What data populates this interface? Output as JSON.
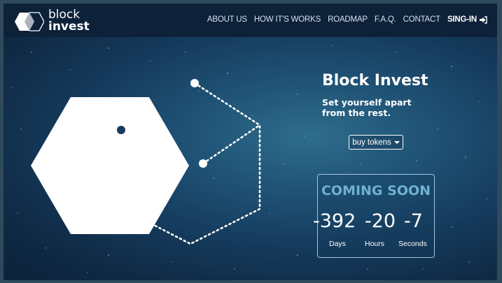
{
  "nav": {
    "logo_line1": "block",
    "logo_line2": "invest",
    "links": [
      "ABOUT US",
      "HOW IT'S WORKS",
      "ROADMAP",
      "F.A.Q.",
      "CONTACT"
    ],
    "signin_label": "SING-IN",
    "signin_icon": "sign-in-icon"
  },
  "hero": {
    "title": "Block Invest",
    "subtitle": "Set yourself apart from the rest.",
    "buy_label": "buy tokens",
    "buy_icon": "caret-down-icon"
  },
  "countdown": {
    "heading": "COMING SOON",
    "days": "-392",
    "hours": "-20",
    "seconds": "-7",
    "days_label": "Days",
    "hours_label": "Hours",
    "seconds_label": "Seconds"
  },
  "colors": {
    "navbar": "#0d2139",
    "background": "#1f5275",
    "accent_coming": "#6fb2cf"
  }
}
